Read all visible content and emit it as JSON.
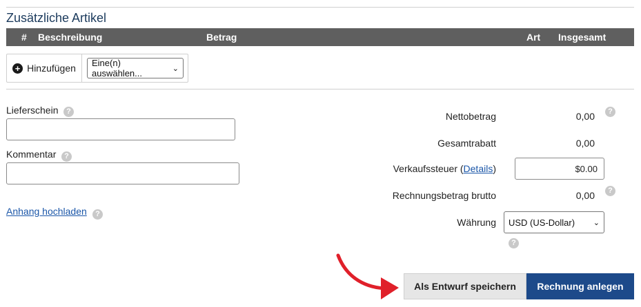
{
  "section": {
    "title": "Zusätzliche Artikel"
  },
  "table": {
    "columns": [
      "#",
      "Beschreibung",
      "Betrag",
      "Art",
      "Insgesamt"
    ]
  },
  "add": {
    "button_label": "Hinzufügen",
    "select_value": "Eine(n) auswählen..."
  },
  "form": {
    "delivery_label": "Lieferschein",
    "delivery_value": "",
    "comment_label": "Kommentar",
    "comment_value": "",
    "upload_link": "Anhang hochladen",
    "help_glyph": "?"
  },
  "summary": {
    "net_label": "Nettobetrag",
    "net_value": "0,00",
    "discount_label": "Gesamtrabatt",
    "discount_value": "0,00",
    "tax_label_prefix": "Verkaufssteuer (",
    "tax_details_link": "Details",
    "tax_label_suffix": ")",
    "tax_value": "$0.00",
    "gross_label": "Rechnungsbetrag brutto",
    "gross_value": "0,00",
    "currency_label": "Währung",
    "currency_value": "USD (US-Dollar)"
  },
  "actions": {
    "draft_label": "Als Entwurf speichern",
    "create_label": "Rechnung anlegen"
  },
  "colors": {
    "accent": "#1d4a8a",
    "header_bg": "#5f5f5f",
    "arrow": "#e0202a"
  },
  "icons": [
    "plus-circle-icon",
    "help-icon",
    "chevron-down-icon",
    "red-arrow-icon"
  ]
}
